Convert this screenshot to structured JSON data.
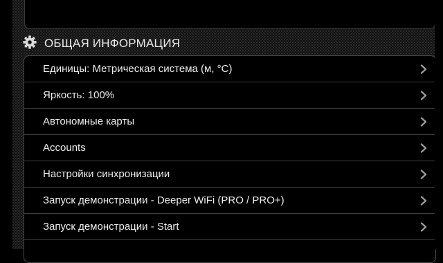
{
  "section": {
    "title": "ОБЩАЯ ИНФОРМАЦИЯ",
    "icon": "gear-icon"
  },
  "items": [
    {
      "label": "Единицы: Метрическая система (м, °C)"
    },
    {
      "label": "Яркость: 100%"
    },
    {
      "label": "Автономные карты"
    },
    {
      "label": "Accounts"
    },
    {
      "label": "Настройки синхронизации"
    },
    {
      "label": "Запуск демонстрации - Deeper WiFi (PRO / PRO+)"
    },
    {
      "label": "Запуск демонстрации - Start"
    }
  ],
  "colors": {
    "background": "#131313",
    "text": "#ededed",
    "chevron": "#9a9a9a"
  }
}
